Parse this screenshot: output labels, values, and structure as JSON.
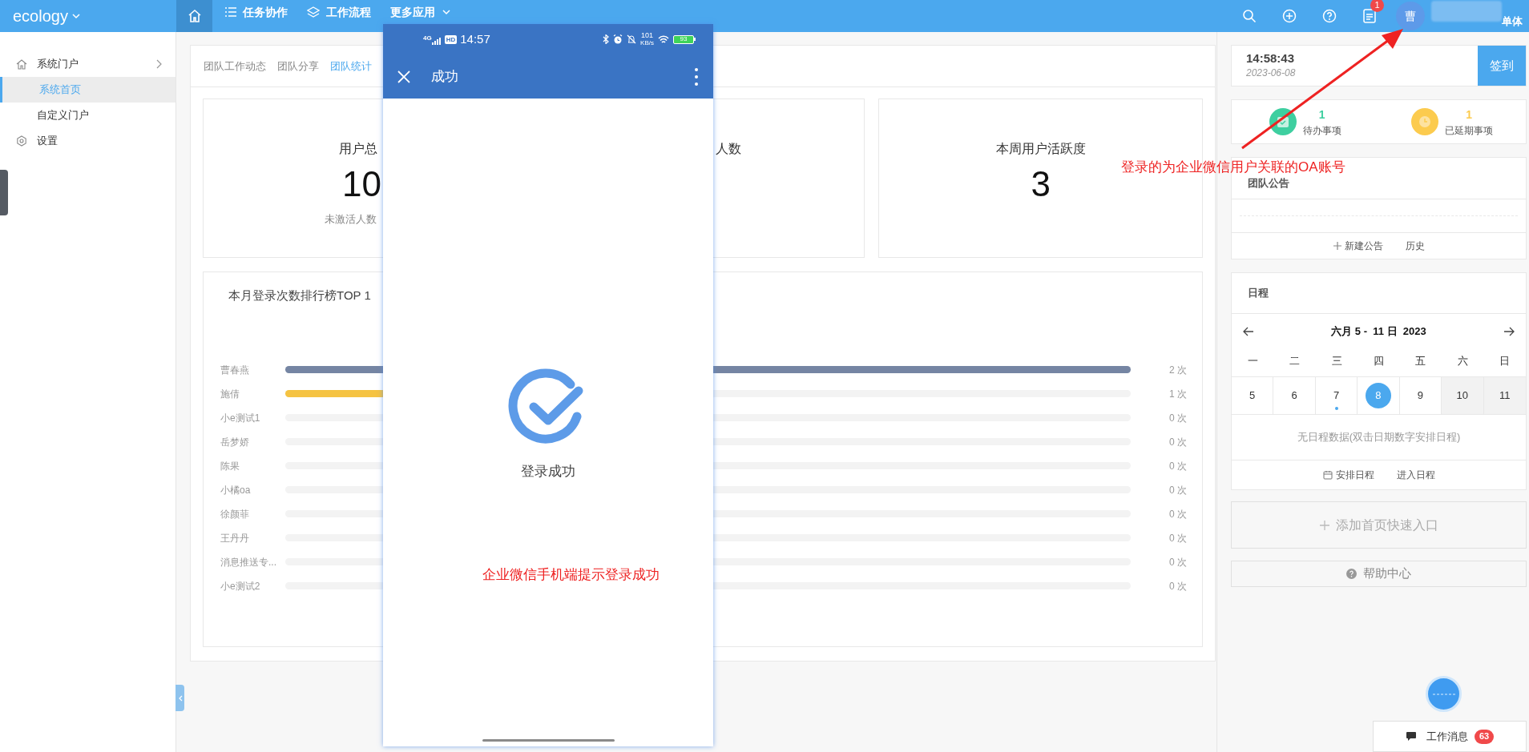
{
  "top_bar": {
    "logo": "ecology",
    "nav": [
      {
        "kind": "home",
        "selected": true
      },
      {
        "kind": "list",
        "label": "任务协作",
        "selected": false
      },
      {
        "kind": "layers",
        "label": "工作流程",
        "selected": false
      },
      {
        "kind": "dropdown",
        "label": "更多应用",
        "selected": false
      }
    ],
    "notification_count": "1",
    "avatar": "曹",
    "user_fragment": "单体"
  },
  "sidebar": {
    "items": [
      {
        "kind": "home",
        "label": "系统门户",
        "children": [
          {
            "label": "系统首页",
            "selected": true
          },
          {
            "label": "自定义门户",
            "selected": false
          }
        ]
      },
      {
        "kind": "gear",
        "label": "设置"
      }
    ]
  },
  "tabs": [
    {
      "label": "团队工作动态",
      "selected": false
    },
    {
      "label": "团队分享",
      "selected": false
    },
    {
      "label": "团队统计",
      "selected": true
    }
  ],
  "stats": [
    {
      "label": "用户总",
      "value": "10",
      "note": "未激活人数"
    },
    {
      "label": "人数"
    },
    {
      "label": "本周用户活跃度",
      "value": "3"
    }
  ],
  "ranking": {
    "title": "本月登录次数排行榜TOP 1",
    "rows": [
      {
        "name": "曹春燕",
        "level": 1,
        "color": "#7585a3",
        "count": "2 次"
      },
      {
        "name": "施倩",
        "level": 0.5,
        "color": "#f5c342",
        "count": "1 次"
      },
      {
        "name": "小e测试1",
        "level": 0,
        "count": "0 次"
      },
      {
        "name": "岳梦娇",
        "level": 0,
        "count": "0 次"
      },
      {
        "name": "陈果",
        "level": 0,
        "count": "0 次"
      },
      {
        "name": "小橘oa",
        "level": 0,
        "count": "0 次"
      },
      {
        "name": "徐颜菲",
        "level": 0,
        "count": "0 次"
      },
      {
        "name": "王丹丹",
        "level": 0,
        "count": "0 次"
      },
      {
        "name": "消息推送专...",
        "level": 0,
        "count": "0 次"
      },
      {
        "name": "小e测试2",
        "level": 0,
        "count": "0 次"
      }
    ]
  },
  "phone": {
    "network": "4G",
    "hd": "HD",
    "time": "14:57",
    "speed": "101",
    "speed_unit": "KB/s",
    "battery": "93",
    "title": "成功",
    "message": "登录成功"
  },
  "annotations": [
    {
      "text": "企业微信手机端提示登录成功"
    },
    {
      "text": "登录的为企业微信用户关联的OA账号"
    }
  ],
  "clock": {
    "time": "14:58:43",
    "date": "2023-06-08",
    "button": "签到"
  },
  "tasks": [
    {
      "count": "1",
      "label": "待办事项",
      "color": "#3ecfa0",
      "kind": "calendar"
    },
    {
      "count": "1",
      "label": "已延期事项",
      "color": "#fccb4e",
      "kind": "clock"
    }
  ],
  "notice": {
    "title": "团队公告",
    "actions": [
      {
        "kind": "add",
        "label": "新建公告"
      },
      {
        "kind": "plain",
        "label": "历史"
      }
    ]
  },
  "schedule": {
    "title": "日程",
    "range": "六月 5 -  11 日  2023",
    "weekdays": [
      "一",
      "二",
      "三",
      "四",
      "五",
      "六",
      "日"
    ],
    "days": [
      {
        "label": "5",
        "selected": false,
        "weekend": false,
        "has_event": false
      },
      {
        "label": "6",
        "selected": false,
        "weekend": false,
        "has_event": false
      },
      {
        "label": "7",
        "selected": false,
        "weekend": false,
        "has_event": true
      },
      {
        "label": "8",
        "selected": true,
        "weekend": false,
        "has_event": false
      },
      {
        "label": "9",
        "selected": false,
        "weekend": false,
        "has_event": false
      },
      {
        "label": "10",
        "selected": false,
        "weekend": true,
        "has_event": false
      },
      {
        "label": "11",
        "selected": false,
        "weekend": true,
        "has_event": false
      }
    ],
    "empty": "无日程数据(双击日期数字安排日程)",
    "actions": [
      {
        "kind": "calendar",
        "label": "安排日程"
      },
      {
        "kind": "plain",
        "label": "进入日程"
      }
    ]
  },
  "quick_entry": "添加首页快速入口",
  "help": "帮助中心",
  "messages": {
    "label": "工作消息",
    "count": "63"
  }
}
